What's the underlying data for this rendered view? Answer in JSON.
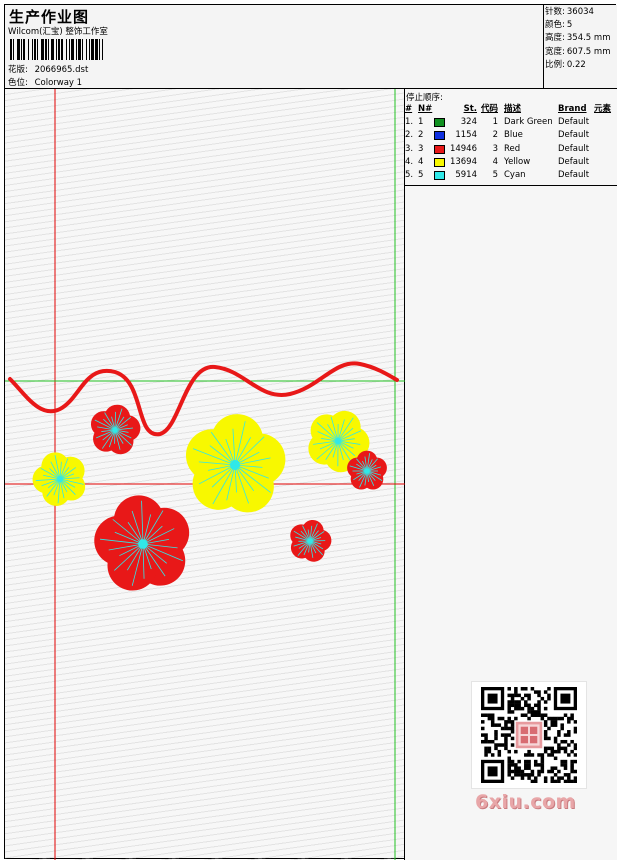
{
  "header": {
    "title": "生产作业图",
    "company": "Wilcom(汇宝) 整饰工作室",
    "design_label": "花版:",
    "design_value": "2066965.dst",
    "colorway_label": "色位:",
    "colorway_value": "Colorway 1"
  },
  "stats": [
    {
      "label": "针数:",
      "value": "36034"
    },
    {
      "label": "颜色:",
      "value": "5"
    },
    {
      "label": "高度:",
      "value": "354.5 mm"
    },
    {
      "label": "宽度:",
      "value": "607.5 mm"
    },
    {
      "label": "比例:",
      "value": "0.22"
    }
  ],
  "stop_sequence": {
    "title": "停止顺序:",
    "headers": {
      "idx": "#",
      "no": "N#",
      "st": "St.",
      "code": "代码",
      "desc": "描述",
      "brand": "Brand",
      "part": "元素"
    },
    "rows": [
      {
        "idx": "1.",
        "no": "1",
        "color": "#109020",
        "st": "324",
        "code": "1",
        "desc": "Dark Green",
        "brand": "Default"
      },
      {
        "idx": "2.",
        "no": "2",
        "color": "#1030e0",
        "st": "1154",
        "code": "2",
        "desc": "Blue",
        "brand": "Default"
      },
      {
        "idx": "3.",
        "no": "3",
        "color": "#e81818",
        "st": "14946",
        "code": "3",
        "desc": "Red",
        "brand": "Default"
      },
      {
        "idx": "4.",
        "no": "4",
        "color": "#f8f800",
        "st": "13694",
        "code": "4",
        "desc": "Yellow",
        "brand": "Default"
      },
      {
        "idx": "5.",
        "no": "5",
        "color": "#30e8e8",
        "st": "5914",
        "code": "5",
        "desc": "Cyan",
        "brand": "Default"
      }
    ]
  },
  "colors": {
    "red": "#e81818",
    "yellow": "#f8f800",
    "cyan": "#30e8e8",
    "guide_green": "#20c020",
    "guide_red": "#e00000"
  },
  "icons": {
    "qr": "qr-code-icon",
    "stamp": "seal-stamp-icon"
  },
  "watermark": {
    "text": "6xiu.com"
  }
}
